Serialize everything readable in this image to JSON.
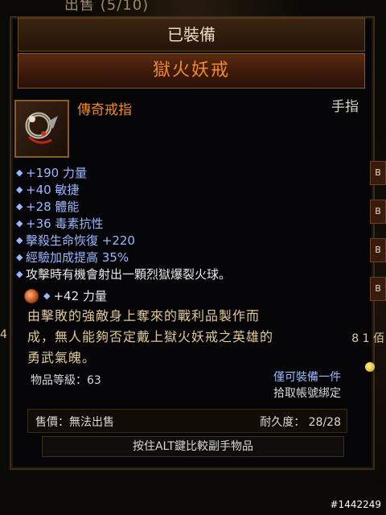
{
  "screen": {
    "top_caption": "出售 (5/10)",
    "equipped_label": "已裝備",
    "item_name": "獄火妖戒",
    "item_type": "傳奇戒指",
    "slot": "手指",
    "stats": [
      "+190 力量",
      "+40 敏捷",
      "+28 體能",
      "+36 毒素抗性",
      "擊殺生命恢復 +220",
      "經驗加成提高 35%",
      "攻擊時有機會射出一顆烈獄爆裂火球。"
    ],
    "gem_bonus": "+42 力量",
    "flavor_text_lines": [
      "由擊敗的強敵身上奪來的戰利品製作而",
      "成，無人能夠否定戴上獄火妖戒之英雄的",
      "勇武氣魄。"
    ],
    "item_level": "物品等級：63",
    "unique_equipped": "僅可裝備一件",
    "bind_on_pickup": "拾取帳號綁定",
    "sell_value": "售價：無法出售",
    "durability": "耐久度： 28/28",
    "alt_compare": "按住ALT鍵比較副手物品",
    "watermark": "#1442249",
    "side_left_number": "4",
    "side_right_text": "8 1 佰",
    "side_tab_labels": [
      "B",
      "B",
      "B",
      "B"
    ]
  },
  "colors": {
    "legendary_orange": "#f08a2a",
    "stat_blue": "#9bb8ff",
    "flavor_gold": "#e0c898",
    "frame_bronze": "#8a5a2a"
  }
}
